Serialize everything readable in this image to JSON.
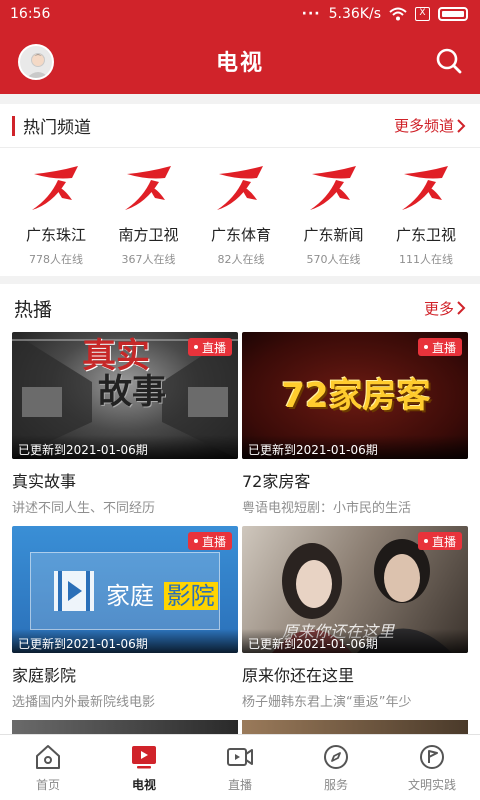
{
  "status_bar": {
    "time": "16:56",
    "speed": "5.36K/s",
    "sim": "X"
  },
  "header": {
    "title": "电视"
  },
  "hot_channels": {
    "title": "热门频道",
    "more": "更多频道",
    "items": [
      {
        "name": "广东珠江",
        "online": "778人在线"
      },
      {
        "name": "南方卫视",
        "online": "367人在线"
      },
      {
        "name": "广东体育",
        "online": "82人在线"
      },
      {
        "name": "广东新闻",
        "online": "570人在线"
      },
      {
        "name": "广东卫视",
        "online": "111人在线"
      }
    ]
  },
  "hot": {
    "title": "热播",
    "more": "更多",
    "cards": [
      {
        "title": "真实故事",
        "subtitle": "讲述不同人生、不同经历",
        "updated": "已更新到2021-01-06期",
        "tag": "直播",
        "thumb_text_1": "真实",
        "thumb_text_2": "故事"
      },
      {
        "title": "72家房客",
        "subtitle": "粤语电视短剧：小市民的生活",
        "updated": "已更新到2021-01-06期",
        "tag": "直播",
        "thumb_text_1": "72家房客"
      },
      {
        "title": "家庭影院",
        "subtitle": "选播国内外最新院线电影",
        "updated": "已更新到2021-01-06期",
        "tag": "直播",
        "thumb_text_1": "家庭",
        "thumb_text_2": "影院"
      },
      {
        "title": "原来你还在这里",
        "subtitle": "杨子姗韩东君上演“重返”年少",
        "updated": "已更新到2021-01-06期",
        "tag": "直播",
        "thumb_text_1": "原来你还在这里"
      }
    ]
  },
  "nav": {
    "items": [
      {
        "label": "首页",
        "icon": "home-icon"
      },
      {
        "label": "电视",
        "icon": "tv-icon"
      },
      {
        "label": "直播",
        "icon": "live-camera-icon"
      },
      {
        "label": "服务",
        "icon": "compass-icon"
      },
      {
        "label": "文明实践",
        "icon": "flag-icon"
      }
    ],
    "active": "电视"
  },
  "colors": {
    "brand": "#d0232a",
    "live_tag": "#e8333b"
  }
}
